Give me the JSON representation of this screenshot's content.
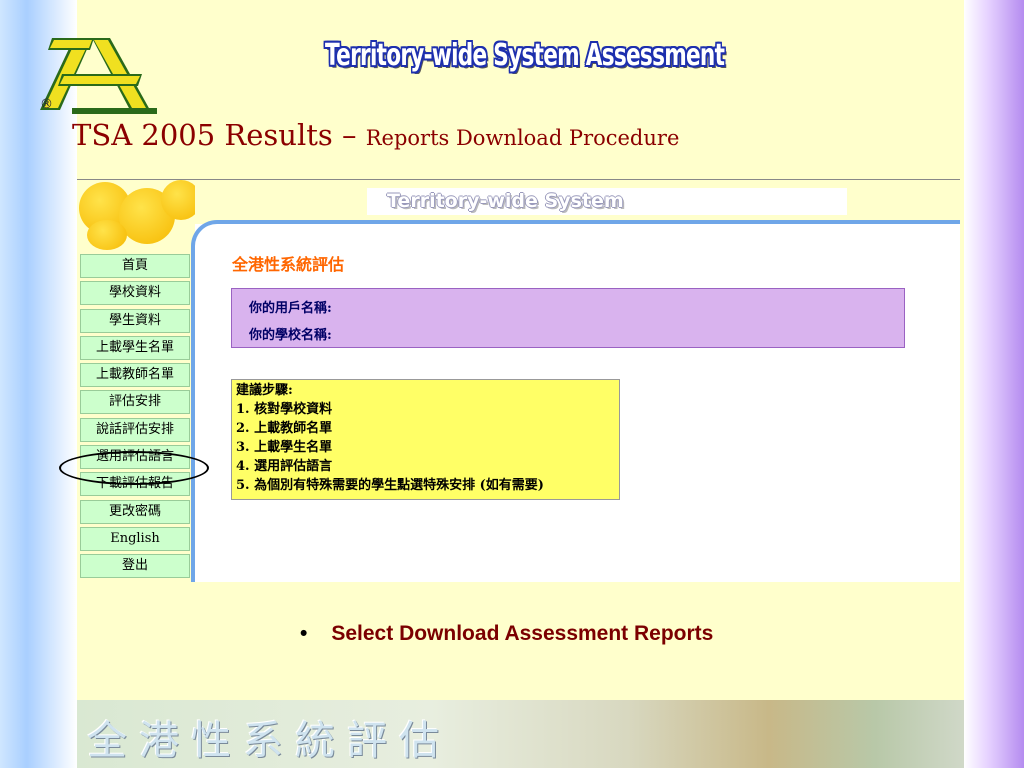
{
  "brand": {
    "registered_mark": "®"
  },
  "banner": {
    "title": "Territory-wide System Assessment"
  },
  "heading": {
    "main": "TSA 2005 Results – ",
    "sub": "Reports Download Procedure"
  },
  "screenshot": {
    "banner_text": "Territory-wide System",
    "menu": [
      {
        "label": "首頁"
      },
      {
        "label": "學校資料"
      },
      {
        "label": "學生資料"
      },
      {
        "label": "上載學生名單"
      },
      {
        "label": "上載教師名單"
      },
      {
        "label": "評估安排"
      },
      {
        "label": "說話評估安排"
      },
      {
        "label": "選用評估語言"
      },
      {
        "label": "下載評估報告"
      },
      {
        "label": "更改密碼"
      },
      {
        "label": "English"
      },
      {
        "label": "登出"
      }
    ],
    "section_title": "全港性系統評估",
    "user_info": {
      "username_label": "你的用戶名稱:",
      "school_label": "你的學校名稱:"
    },
    "steps": {
      "title": "建議步驟:",
      "items": [
        "1. 核對學校資料",
        "2. 上載教師名單",
        "3. 上載學生名單",
        "4. 選用評估語言",
        "5. 為個別有特殊需要的學生點選特殊安排 (如有需要)"
      ]
    }
  },
  "bullet": {
    "marker": "•",
    "text": "Select Download Assessment Reports"
  },
  "footer": {
    "text": "全港性系統評估"
  },
  "colors": {
    "slide_bg": "#ffffcc",
    "heading": "#8b0000",
    "banner_outline": "#1d2fae",
    "menu_bg": "#ccffcc",
    "userbox_bg": "#d9b3ee",
    "steps_bg": "#ffff66",
    "section_title": "#ff6600",
    "bullet_text": "#7b0000"
  }
}
